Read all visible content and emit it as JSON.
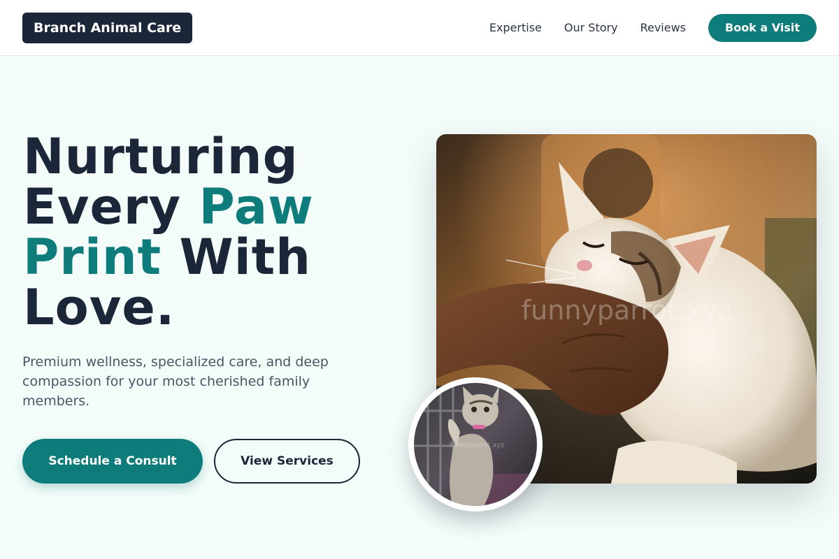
{
  "header": {
    "logo": "Branch Animal Care",
    "nav": [
      "Expertise",
      "Our Story",
      "Reviews"
    ],
    "cta": "Book a Visit"
  },
  "hero": {
    "headline": {
      "line1": "Nurturing",
      "line2a": "Every ",
      "line2b": "Paw",
      "line3a": "Print",
      "line3b": " With",
      "line4": "Love."
    },
    "subtext": "Premium wellness, specialized care, and deep compassion for your most cherished family members.",
    "primary_button": "Schedule a Consult",
    "secondary_button": "View Services"
  },
  "images": {
    "main_watermark": "funnyparrot.xyz",
    "inset_watermark": "funnyparrot.xyz"
  },
  "colors": {
    "brand_dark": "#1c2639",
    "accent_teal": "#0e7c7b",
    "page_background": "#f3fcf9"
  }
}
